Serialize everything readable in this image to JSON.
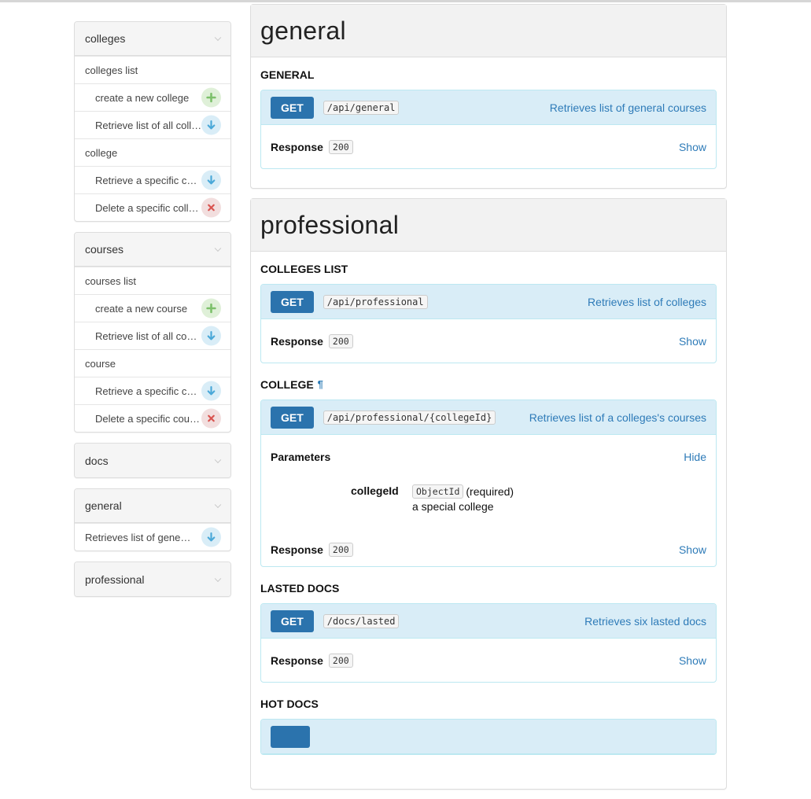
{
  "sidebar": {
    "panels": [
      {
        "title": "colleges",
        "rows": [
          {
            "kind": "group",
            "label": "colleges list"
          },
          {
            "kind": "ep",
            "label": "create a new college",
            "method": "post"
          },
          {
            "kind": "ep",
            "label": "Retrieve list of all colleges",
            "method": "get"
          },
          {
            "kind": "group",
            "label": "college"
          },
          {
            "kind": "ep",
            "label": "Retrieve a specific college",
            "method": "get"
          },
          {
            "kind": "ep",
            "label": "Delete a specific college",
            "method": "delete"
          }
        ]
      },
      {
        "title": "courses",
        "rows": [
          {
            "kind": "group",
            "label": "courses list"
          },
          {
            "kind": "ep",
            "label": "create a new course",
            "method": "post"
          },
          {
            "kind": "ep",
            "label": "Retrieve list of all courses",
            "method": "get"
          },
          {
            "kind": "group",
            "label": "course"
          },
          {
            "kind": "ep",
            "label": "Retrieve a specific course",
            "method": "get"
          },
          {
            "kind": "ep",
            "label": "Delete a specific course",
            "method": "delete"
          }
        ]
      },
      {
        "title": "docs",
        "rows": []
      },
      {
        "title": "general",
        "rows": [
          {
            "kind": "group",
            "label": "Retrieves list of general courses",
            "method": "get"
          }
        ]
      },
      {
        "title": "professional",
        "rows": []
      }
    ]
  },
  "main": {
    "general": {
      "heading": "general",
      "resource_title": "GENERAL",
      "endpoint": {
        "method": "GET",
        "path": "/api/general",
        "description": "Retrieves list of general courses",
        "response_label": "Response",
        "response_code": "200",
        "toggle": "Show"
      }
    },
    "professional": {
      "heading": "professional",
      "resources": {
        "colleges_list": {
          "title": "COLLEGES LIST",
          "method": "GET",
          "path": "/api/professional",
          "description": "Retrieves list of colleges",
          "response_label": "Response",
          "response_code": "200",
          "toggle": "Show"
        },
        "college": {
          "title": "COLLEGE",
          "pilcrow": "¶",
          "method": "GET",
          "path": "/api/professional/{collegeId}",
          "description": "Retrieves list of a colleges's courses",
          "params_label": "Parameters",
          "params_toggle": "Hide",
          "param_name": "collegeId",
          "param_type": "ObjectId",
          "param_required": "(required)",
          "param_desc": "a special college",
          "response_label": "Response",
          "response_code": "200",
          "toggle": "Show"
        },
        "lasted_docs": {
          "title": "LASTED DOCS",
          "method": "GET",
          "path": "/docs/lasted",
          "description": "Retrieves six lasted docs",
          "response_label": "Response",
          "response_code": "200",
          "toggle": "Show"
        },
        "hot_docs": {
          "title": "HOT DOCS"
        }
      }
    }
  }
}
